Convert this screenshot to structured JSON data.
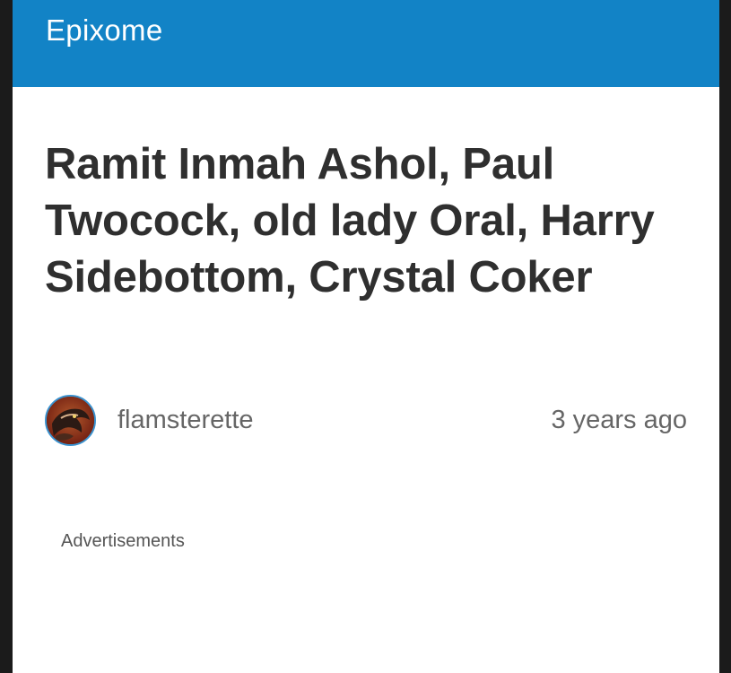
{
  "header": {
    "site_title": "Epixome",
    "background_color": "#1283c6"
  },
  "post": {
    "title": "Ramit Inmah Ashol, Paul Twocock, old lady Oral, Harry Sidebottom, Crystal Coker",
    "author": {
      "name": "flamsterette",
      "avatar_icon": "dragon-avatar-icon"
    },
    "time_ago": "3 years ago"
  },
  "ads": {
    "label": "Advertisements"
  }
}
